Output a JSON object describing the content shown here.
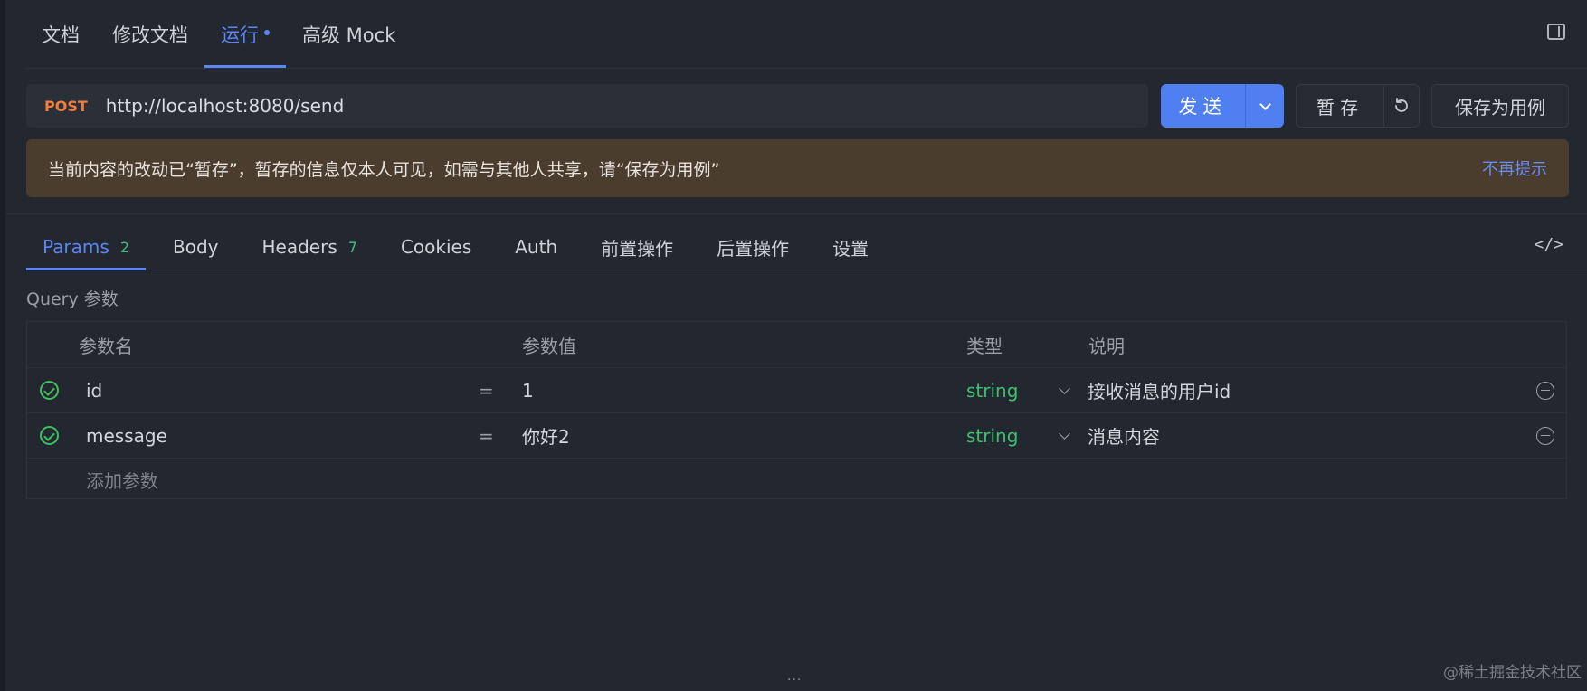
{
  "top_tabs": [
    {
      "label": "文档"
    },
    {
      "label": "修改文档"
    },
    {
      "label": "运行"
    },
    {
      "label": "高级 Mock"
    }
  ],
  "request": {
    "method": "POST",
    "url": "http://localhost:8080/send",
    "send_label": "发送",
    "temp_save_label": "暂存",
    "save_case_label": "保存为用例"
  },
  "notice": {
    "text": "当前内容的改动已“暂存”，暂存的信息仅本人可见，如需与其他人共享，请“保存为用例”",
    "dismiss": "不再提示"
  },
  "req_tabs": [
    {
      "label": "Params",
      "count": "2"
    },
    {
      "label": "Body"
    },
    {
      "label": "Headers",
      "count": "7"
    },
    {
      "label": "Cookies"
    },
    {
      "label": "Auth"
    },
    {
      "label": "前置操作"
    },
    {
      "label": "后置操作"
    },
    {
      "label": "设置"
    }
  ],
  "query": {
    "section_label": "Query 参数",
    "headers": {
      "name": "参数名",
      "value": "参数值",
      "type": "类型",
      "desc": "说明"
    },
    "rows": [
      {
        "name": "id",
        "eq": "=",
        "value": "1",
        "type": "string",
        "desc": "接收消息的用户id"
      },
      {
        "name": "message",
        "eq": "=",
        "value": "你好2",
        "type": "string",
        "desc": "消息内容"
      }
    ],
    "add_placeholder": "添加参数"
  },
  "resize_handle": "···",
  "watermark": "@稀土掘金技术社区",
  "colors": {
    "accent": "#5b87f5",
    "method_post": "#f07c3e",
    "type_string": "#3fbf6f",
    "notice_bg": "#4a3d2e"
  }
}
